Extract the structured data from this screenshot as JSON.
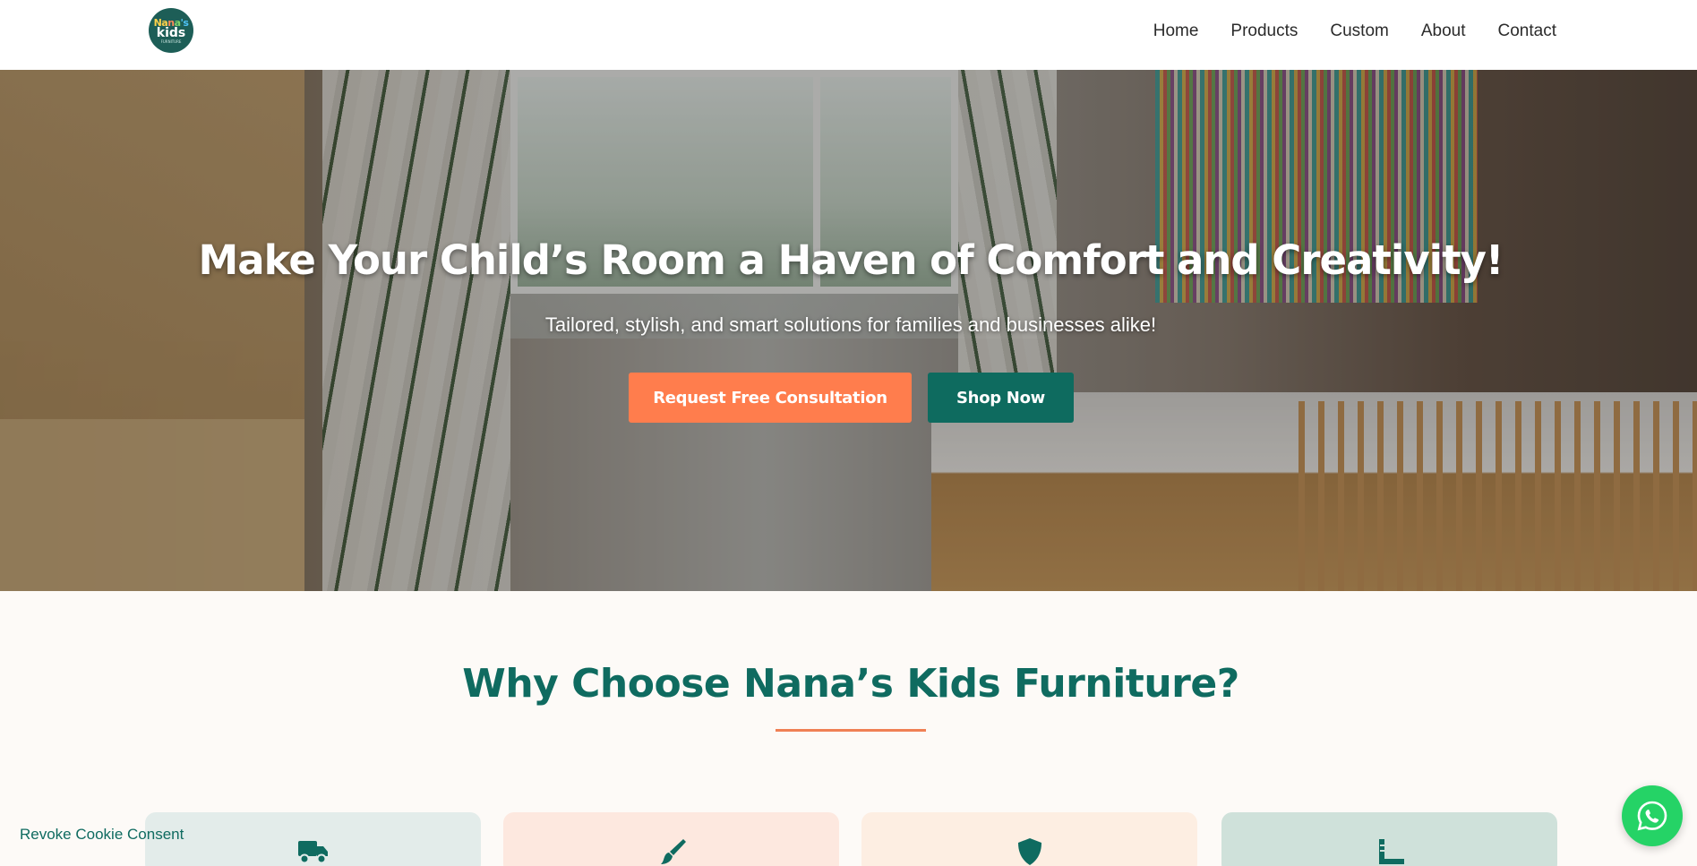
{
  "brand": {
    "logo_line1": "Nana's",
    "logo_line2": "kids",
    "logo_line3": "FURNITURE"
  },
  "nav": {
    "items": [
      {
        "label": "Home"
      },
      {
        "label": "Products"
      },
      {
        "label": "Custom"
      },
      {
        "label": "About"
      },
      {
        "label": "Contact"
      }
    ]
  },
  "hero": {
    "title": "Make Your Child’s Room a Haven of Comfort and Creativity!",
    "subtitle": "Tailored, stylish, and smart solutions for families and businesses alike!",
    "primary_button": "Request Free Consultation",
    "secondary_button": "Shop Now"
  },
  "why": {
    "title": "Why Choose Nana’s Kids Furniture?",
    "cards": [
      {
        "icon": "truck-icon"
      },
      {
        "icon": "paintbrush-icon"
      },
      {
        "icon": "shield-icon"
      },
      {
        "icon": "ruler-icon"
      }
    ]
  },
  "cookie": {
    "revoke_label": "Revoke Cookie Consent"
  },
  "colors": {
    "primary_teal": "#0f6b60",
    "accent_orange": "#ff7d4d",
    "whatsapp_green": "#25d366"
  }
}
